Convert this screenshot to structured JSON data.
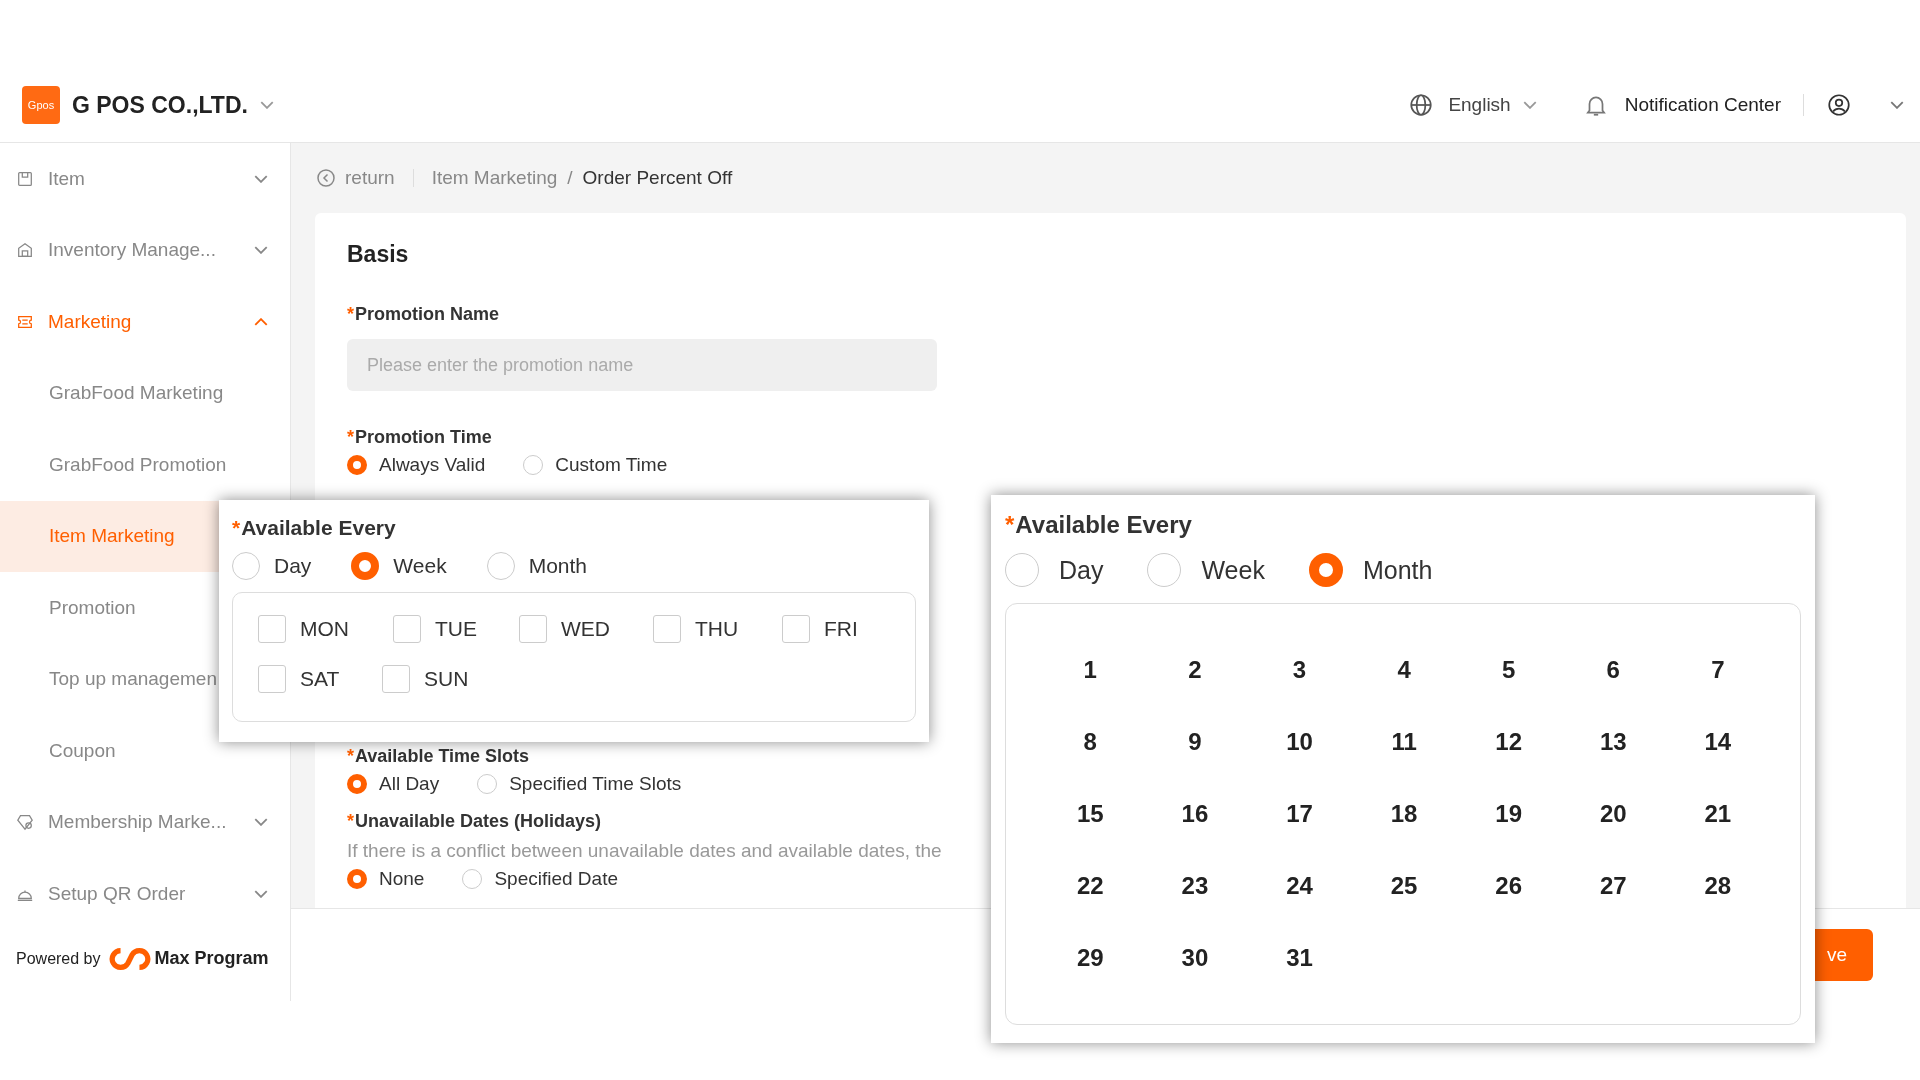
{
  "header": {
    "logo": "Gpos",
    "company": "G POS CO.,LTD.",
    "language": "English",
    "notification": "Notification Center"
  },
  "sidebar": {
    "items": [
      {
        "label": "Item",
        "expanded": false,
        "selected": false
      },
      {
        "label": "Inventory Manage...",
        "expanded": false,
        "selected": false
      },
      {
        "label": "Marketing",
        "expanded": true,
        "selected": true,
        "children": [
          {
            "label": "GrabFood Marketing",
            "selected": false
          },
          {
            "label": "GrabFood Promotion",
            "selected": false
          },
          {
            "label": "Item Marketing",
            "selected": true
          },
          {
            "label": "Promotion",
            "selected": false
          },
          {
            "label": "Top up managemen",
            "selected": false
          },
          {
            "label": "Coupon",
            "selected": false
          }
        ]
      },
      {
        "label": "Membership Marke...",
        "expanded": false,
        "selected": false
      },
      {
        "label": "Setup QR Order",
        "expanded": false,
        "selected": false
      }
    ],
    "powered": {
      "prefix": "Powered by",
      "brand": "Max Program"
    }
  },
  "breadcrumb": {
    "back": "return",
    "separator": "/",
    "trail": [
      "Item Marketing",
      "Order Percent Off"
    ]
  },
  "form": {
    "section": "Basis",
    "promotion_name": {
      "label": "Promotion Name",
      "required_mark": "*",
      "placeholder": "Please enter the promotion name"
    },
    "promotion_time": {
      "label": "Promotion Time",
      "required_mark": "*",
      "options": [
        {
          "label": "Always Valid",
          "selected": true
        },
        {
          "label": "Custom Time",
          "selected": false
        }
      ]
    },
    "time_slots": {
      "label": "Available Time Slots",
      "required_mark": "*",
      "options": [
        {
          "label": "All Day",
          "selected": true
        },
        {
          "label": "Specified Time Slots",
          "selected": false
        }
      ]
    },
    "unavailable": {
      "label": "Unavailable Dates (Holidays)",
      "required_mark": "*",
      "hint": "If there is a conflict between unavailable dates and available dates, the",
      "options": [
        {
          "label": "None",
          "selected": true
        },
        {
          "label": "Specified Date",
          "selected": false
        }
      ]
    },
    "save_button": "ve"
  },
  "callouts": [
    {
      "kind": "week",
      "title": "Available Every",
      "required_mark": "*",
      "options": [
        {
          "label": "Day",
          "selected": false
        },
        {
          "label": "Week",
          "selected": true
        },
        {
          "label": "Month",
          "selected": false
        }
      ],
      "days": [
        {
          "label": "MON",
          "checked": false
        },
        {
          "label": "TUE",
          "checked": false
        },
        {
          "label": "WED",
          "checked": false
        },
        {
          "label": "THU",
          "checked": false
        },
        {
          "label": "FRI",
          "checked": false
        },
        {
          "label": "SAT",
          "checked": false
        },
        {
          "label": "SUN",
          "checked": false
        }
      ]
    },
    {
      "kind": "month",
      "title": "Available Every",
      "required_mark": "*",
      "options": [
        {
          "label": "Day",
          "selected": false
        },
        {
          "label": "Week",
          "selected": false
        },
        {
          "label": "Month",
          "selected": true
        }
      ],
      "dates": [
        "1",
        "2",
        "3",
        "4",
        "5",
        "6",
        "7",
        "8",
        "9",
        "10",
        "11",
        "12",
        "13",
        "14",
        "15",
        "16",
        "17",
        "18",
        "19",
        "20",
        "21",
        "22",
        "23",
        "24",
        "25",
        "26",
        "27",
        "28",
        "29",
        "30",
        "31"
      ]
    }
  ]
}
